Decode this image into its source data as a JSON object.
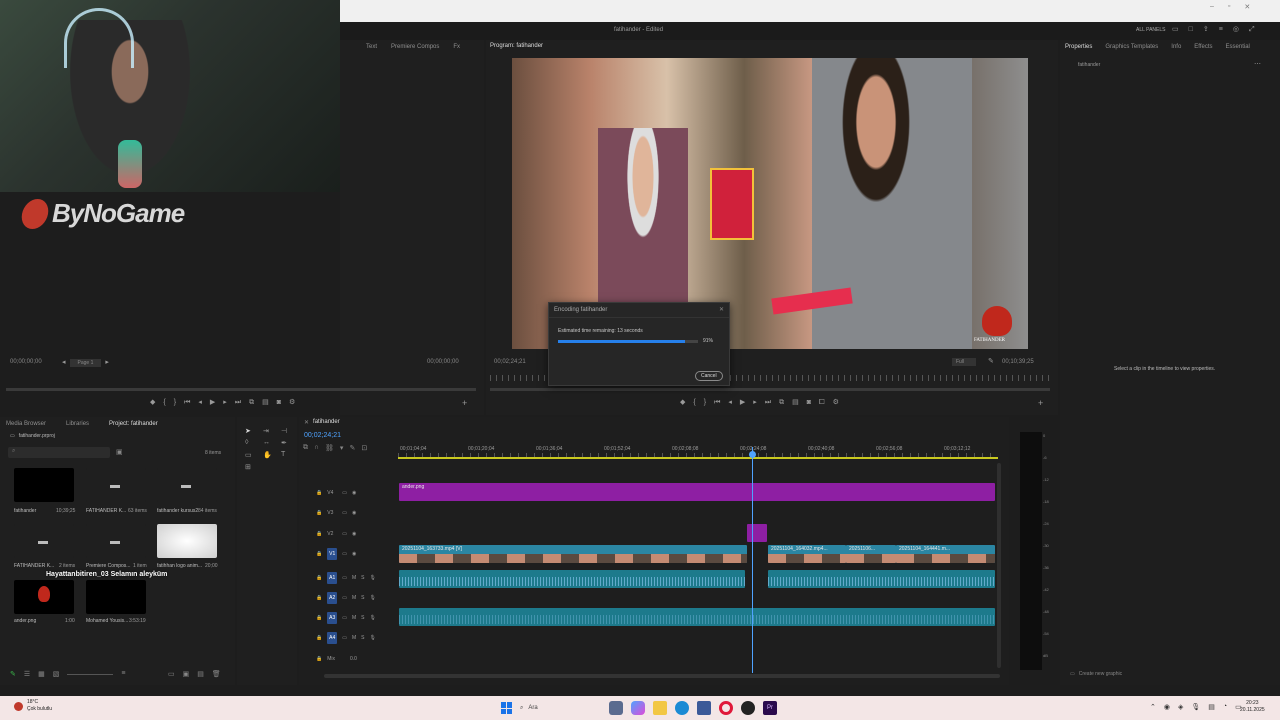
{
  "titlebar": {
    "project": "fatihander - Edited",
    "all_panels": "ALL PANELS"
  },
  "branding": {
    "logo_text": "ByNoGame"
  },
  "source_monitor": {
    "tabs": [
      "Text",
      "Premiere Compos",
      "Fx"
    ],
    "timecode_left": "00;00;00;00",
    "page": "Page 1",
    "timecode_right": "00;00;00;00"
  },
  "program_monitor": {
    "tab": "Program: fatihander",
    "timecode_left": "00;02;24;21",
    "fit": "Full",
    "timecode_right": "00;10;39;25",
    "watermark": "FATIHANDER"
  },
  "encoding_dialog": {
    "title": "Encoding fatihander",
    "status": "Estimated time remaining: 13 seconds",
    "percent_text": "91%",
    "progress": 0.91,
    "cancel": "Cancel"
  },
  "properties": {
    "tabs": [
      "Properties",
      "Graphics Templates",
      "Info",
      "Effects",
      "Essential"
    ],
    "subtitle": "fatihander",
    "empty_text": "Select a clip in the timeline to view properties.",
    "create_graphic": "Create new graphic"
  },
  "project_panel": {
    "tabs": [
      "Media Browser",
      "Libraries",
      "Project: fatihander"
    ],
    "file": "fatihander.prproj",
    "items_count": "8 items",
    "items": [
      {
        "name": "fatihander",
        "meta": "10;39;25"
      },
      {
        "name": "FATIHANDER K...",
        "meta": "63 items"
      },
      {
        "name": "fatihander kursus2",
        "meta": "84 items"
      },
      {
        "name": "FATIHANDER K...",
        "meta": "2 items"
      },
      {
        "name": "Premiere Compos...",
        "meta": "1 item"
      },
      {
        "name": "fatihhan logo anim...",
        "meta": "20;00"
      },
      {
        "name": "ander.png",
        "meta": "1:00"
      },
      {
        "name": "Mohamed Yousis...",
        "meta": "3:53:19"
      }
    ],
    "overlay_text": "Hayattanbitiren_03 Selamın aleyküm"
  },
  "timeline": {
    "tab": "fatihander",
    "timecode": "00;02;24;21",
    "ruler": [
      "00;01;04;04",
      "00;01;20;04",
      "00;01;36;04",
      "00;01;52;04",
      "00;02;08;08",
      "00;02;24;08",
      "00;02;40;08",
      "00;02;56;08",
      "00;03;12;12"
    ],
    "video_tracks": [
      "V4",
      "V3",
      "V2",
      "V1"
    ],
    "audio_tracks": [
      "A1",
      "A2",
      "A3",
      "A4"
    ],
    "mix_label": "Mix",
    "mix_value": "0.0",
    "clips": {
      "graphic": "ander.png",
      "v1_a": "20251104_163733.mp4 [V]",
      "v1_b": "20251104_164032.mp4...",
      "v1_c": "20251106...",
      "v1_d": "20251104_164441.m..."
    }
  },
  "meter_scale": [
    "0",
    "-6",
    "-12",
    "-18",
    "-24",
    "-30",
    "-36",
    "-42",
    "-48",
    "-54",
    "dB"
  ],
  "taskbar": {
    "weather_temp": "18°C",
    "weather_desc": "Çok bulutlu",
    "search": "Ara",
    "time": "20:23",
    "date": "20.11.2025"
  },
  "colors": {
    "accent": "#2680eb",
    "graphic_clip": "#a020b0",
    "video_clip": "#2e8aa6",
    "audio_clip": "#1e7f8f",
    "playhead": "#4fa3ff"
  }
}
